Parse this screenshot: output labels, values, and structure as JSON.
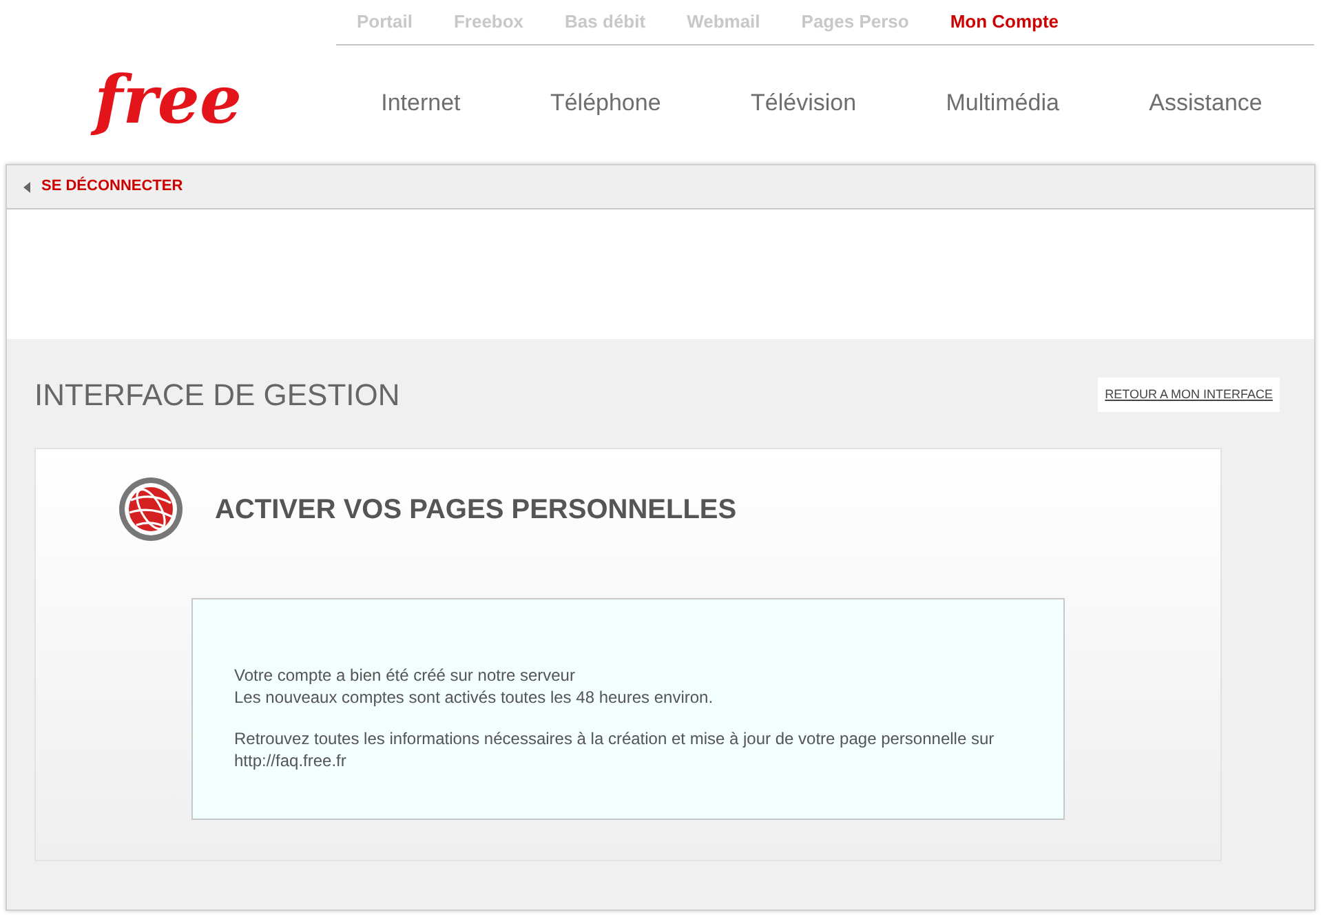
{
  "top_links": [
    {
      "label": "Portail",
      "selected": false
    },
    {
      "label": "Freebox",
      "selected": false
    },
    {
      "label": "Bas débit",
      "selected": false
    },
    {
      "label": "Webmail",
      "selected": false
    },
    {
      "label": "Pages Perso",
      "selected": false
    },
    {
      "label": "Mon Compte",
      "selected": true
    }
  ],
  "logo": "free",
  "main_nav": [
    "Internet",
    "Téléphone",
    "Télévision",
    "Multimédia",
    "Assistance"
  ],
  "logout": "SE DÉCONNECTER",
  "page_title": "INTERFACE DE GESTION",
  "back_link": "RETOUR A MON INTERFACE",
  "card": {
    "heading": "ACTIVER VOS PAGES PERSONNELLES",
    "message": [
      "Votre compte a bien été créé sur notre serveur\nLes nouveaux comptes sont activés toutes les 48 heures environ.",
      "Retrouvez toutes les informations nécessaires à la création et mise à jour de votre page personnelle sur\nhttp://faq.free.fr"
    ]
  }
}
